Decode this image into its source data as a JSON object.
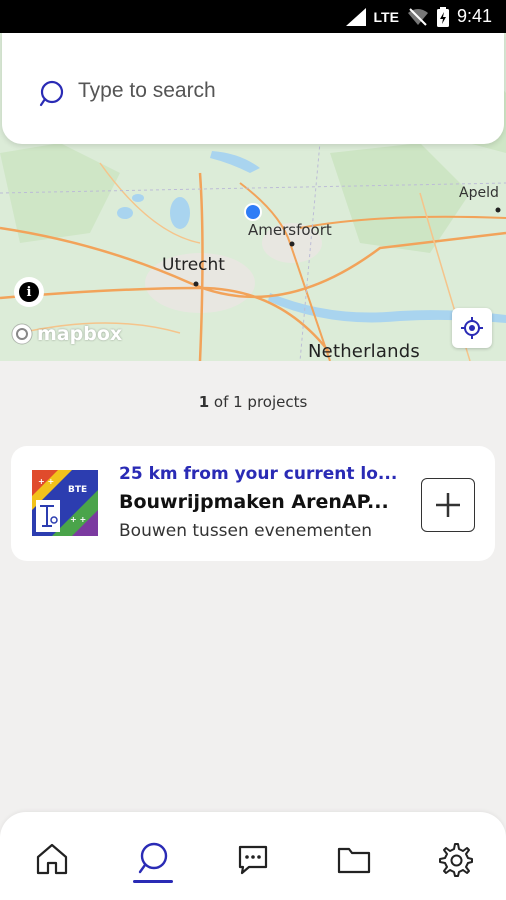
{
  "status_bar": {
    "network": "LTE",
    "time": "9:41"
  },
  "search": {
    "placeholder": "Type to search",
    "icon": "search-icon"
  },
  "map": {
    "labels": {
      "utrecht": "Utrecht",
      "amersfoort": "Amersfoort",
      "apeldoorn": "Apeld",
      "netherlands": "Netherlands"
    },
    "attribution": "mapbox"
  },
  "projects": {
    "count_current": "1",
    "count_text": " of 1 projects",
    "items": [
      {
        "distance": "25 km from your current lo...",
        "title": "Bouwrijpmaken ArenAP...",
        "subtitle": "Bouwen tussen evenementen",
        "thumb_label": "BTE"
      }
    ]
  },
  "nav": {
    "items": [
      "home-icon",
      "search-icon",
      "chat-icon",
      "folder-icon",
      "gear-icon"
    ],
    "active": "search"
  },
  "colors": {
    "accent": "#2a2bb5",
    "location_dot": "#2f7df6",
    "map_green": "#dfeedd"
  }
}
